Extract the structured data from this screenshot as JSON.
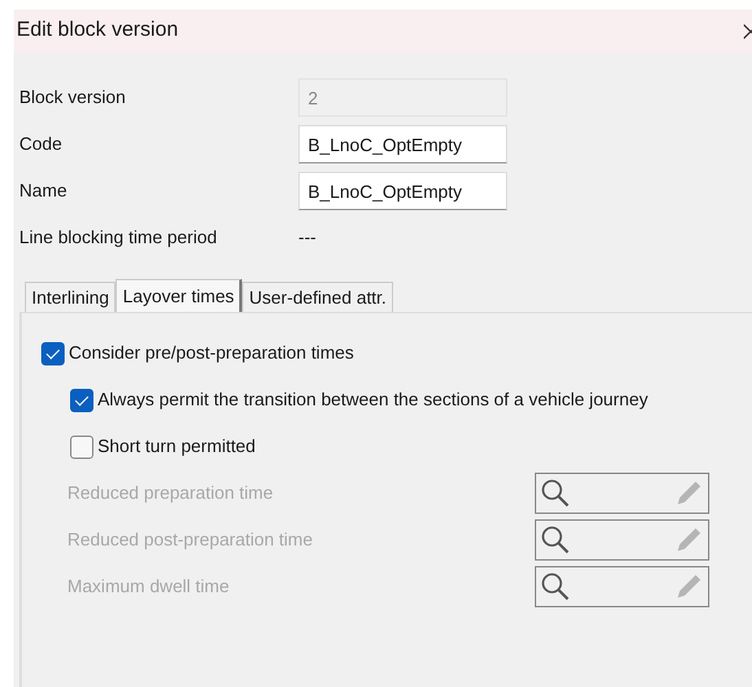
{
  "window": {
    "title": "Edit block version"
  },
  "fields": [
    {
      "kind": "input",
      "label": "Block version",
      "value": "2",
      "disabled": true
    },
    {
      "kind": "input",
      "label": "Code",
      "value": "B_LnoC_OptEmpty",
      "disabled": false
    },
    {
      "kind": "input",
      "label": "Name",
      "value": "B_LnoC_OptEmpty",
      "disabled": false
    },
    {
      "kind": "text",
      "label": "Line blocking time period",
      "value": "---"
    }
  ],
  "tabs": [
    {
      "label": "Interlining",
      "selected": false
    },
    {
      "label": "Layover times",
      "selected": true
    },
    {
      "label": "User-defined attr.",
      "selected": false
    }
  ],
  "options": [
    {
      "label": "Consider pre/post-preparation times",
      "checked": true,
      "children": [
        {
          "label": "Always permit the transition between the sections of a vehicle journey",
          "checked": true
        },
        {
          "label": "Short turn permitted",
          "checked": false
        }
      ]
    }
  ],
  "lookups": [
    {
      "label": "Reduced preparation time",
      "disabled": true
    },
    {
      "label": "Reduced post-preparation time",
      "disabled": true
    },
    {
      "label": "Maximum dwell time",
      "disabled": true
    }
  ]
}
